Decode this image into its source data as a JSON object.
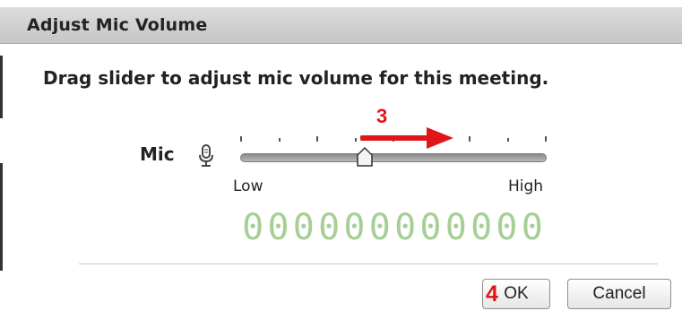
{
  "dialog": {
    "title": "Adjust Mic Volume",
    "instruction": "Drag slider to adjust mic volume for this meeting."
  },
  "mic": {
    "label": "Mic",
    "icon": "microphone-icon",
    "slider": {
      "low_label": "Low",
      "high_label": "High",
      "value_fraction": 0.41,
      "tick_count": 5
    },
    "level_meter": {
      "digits": [
        "0",
        "0",
        "0",
        "0",
        "0",
        "0",
        "0",
        "0",
        "0",
        "0",
        "0",
        "0"
      ],
      "color": "#a6cf96"
    }
  },
  "buttons": {
    "ok_label": "OK",
    "cancel_label": "Cancel"
  },
  "annotations": {
    "step3": "3",
    "step4": "4",
    "color": "#e0161a"
  }
}
